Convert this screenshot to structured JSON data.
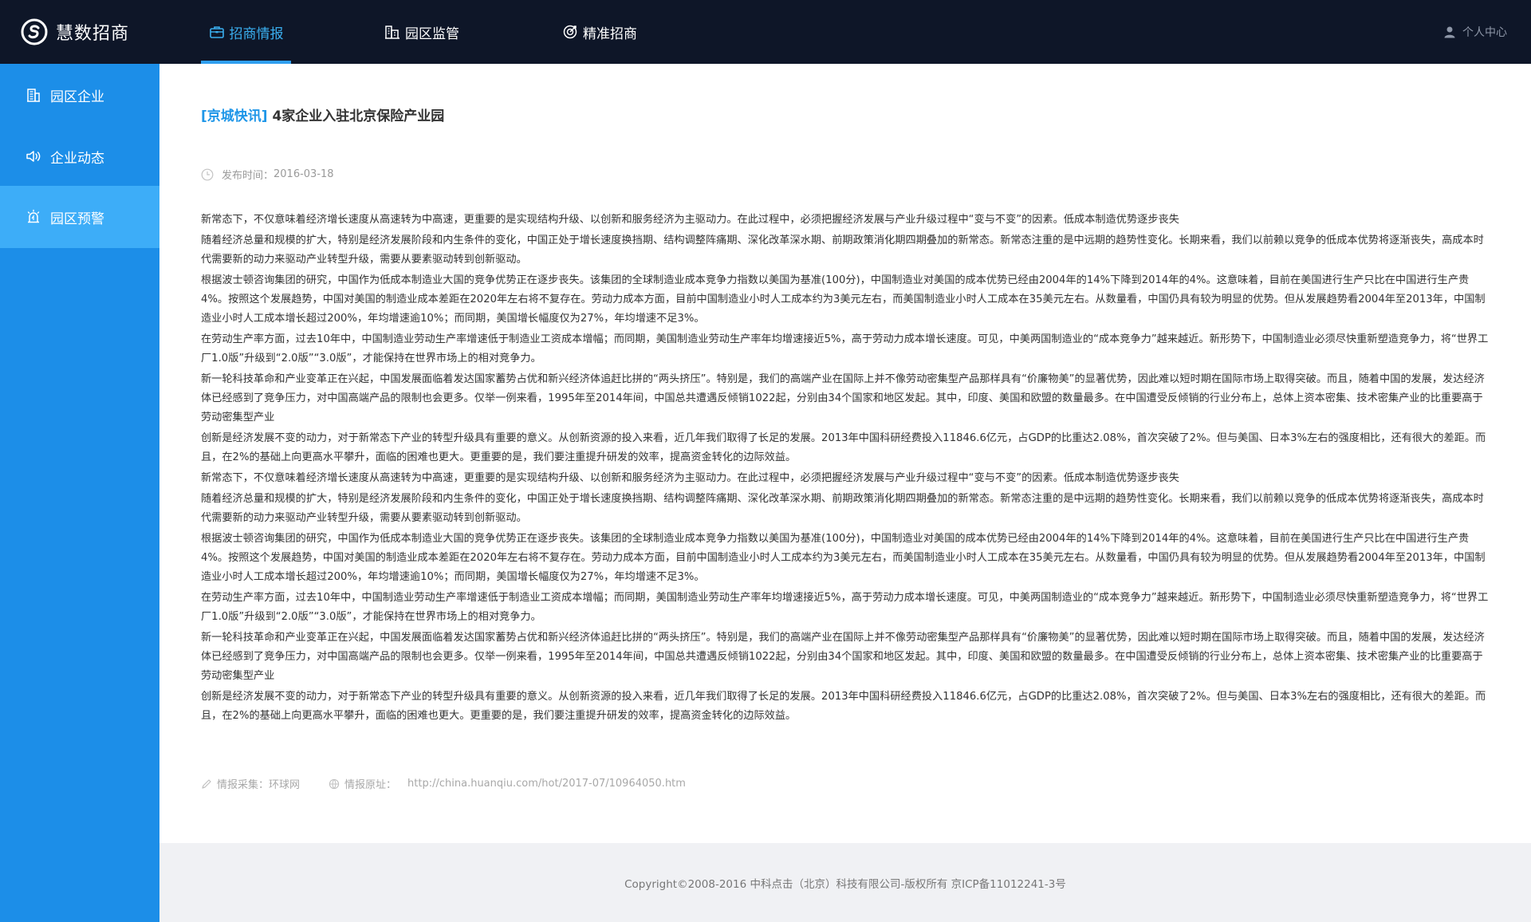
{
  "app": {
    "title": "慧数招商"
  },
  "nav": {
    "items": [
      {
        "label": "招商情报",
        "icon": "briefcase-icon",
        "active": true
      },
      {
        "label": "园区监管",
        "icon": "buildings-icon",
        "active": false
      },
      {
        "label": "精准招商",
        "icon": "target-icon",
        "active": false
      }
    ],
    "user_center": "个人中心"
  },
  "sidebar": {
    "items": [
      {
        "label": "园区企业",
        "icon": "building-icon",
        "active": false
      },
      {
        "label": "企业动态",
        "icon": "speaker-icon",
        "active": false
      },
      {
        "label": "园区预警",
        "icon": "alarm-icon",
        "active": true
      }
    ]
  },
  "article": {
    "tag": "[京城快讯]",
    "title": " 4家企业入驻北京保险产业园",
    "publish_label": "发布时间：",
    "publish_date": "2016-03-18",
    "paragraphs": [
      "新常态下，不仅意味着经济增长速度从高速转为中高速，更重要的是实现结构升级、以创新和服务经济为主驱动力。在此过程中，必须把握经济发展与产业升级过程中“变与不变”的因素。低成本制造优势逐步丧失",
      "随着经济总量和规模的扩大，特别是经济发展阶段和内生条件的变化，中国正处于增长速度换挡期、结构调整阵痛期、深化改革深水期、前期政策消化期四期叠加的新常态。新常态注重的是中远期的趋势性变化。长期来看，我们以前赖以竞争的低成本优势将逐渐丧失，高成本时代需要新的动力来驱动产业转型升级，需要从要素驱动转到创新驱动。",
      "根据波士顿咨询集团的研究，中国作为低成本制造业大国的竞争优势正在逐步丧失。该集团的全球制造业成本竞争力指数以美国为基准(100分)，中国制造业对美国的成本优势已经由2004年的14%下降到2014年的4%。这意味着，目前在美国进行生产只比在中国进行生产贵4%。按照这个发展趋势，中国对美国的制造业成本差距在2020年左右将不复存在。劳动力成本方面，目前中国制造业小时人工成本约为3美元左右，而美国制造业小时人工成本在35美元左右。从数量看，中国仍具有较为明显的优势。但从发展趋势看2004年至2013年，中国制造业小时人工成本增长超过200%，年均增速逾10%；而同期，美国增长幅度仅为27%，年均增速不足3%。",
      "在劳动生产率方面，过去10年中，中国制造业劳动生产率增速低于制造业工资成本增幅；而同期，美国制造业劳动生产率年均增速接近5%，高于劳动力成本增长速度。可见，中美两国制造业的“成本竞争力”越来越近。新形势下，中国制造业必须尽快重新塑造竞争力，将“世界工厂1.0版”升级到“2.0版”“3.0版”，才能保持在世界市场上的相对竞争力。",
      "新一轮科技革命和产业变革正在兴起，中国发展面临着发达国家蓄势占优和新兴经济体追赶比拼的“两头挤压”。特别是，我们的高端产业在国际上并不像劳动密集型产品那样具有“价廉物美”的显著优势，因此难以短时期在国际市场上取得突破。而且，随着中国的发展，发达经济体已经感到了竞争压力，对中国高端产品的限制也会更多。仅举一例来看，1995年至2014年间，中国总共遭遇反倾销1022起，分别由34个国家和地区发起。其中，印度、美国和欧盟的数量最多。在中国遭受反倾销的行业分布上，总体上资本密集、技术密集产业的比重要高于劳动密集型产业",
      "创新是经济发展不变的动力，对于新常态下产业的转型升级具有重要的意义。从创新资源的投入来看，近几年我们取得了长足的发展。2013年中国科研经费投入11846.6亿元，占GDP的比重达2.08%，首次突破了2%。但与美国、日本3%左右的强度相比，还有很大的差距。而且，在2%的基础上向更高水平攀升，面临的困难也更大。更重要的是，我们要注重提升研发的效率，提高资金转化的边际效益。",
      "新常态下，不仅意味着经济增长速度从高速转为中高速，更重要的是实现结构升级、以创新和服务经济为主驱动力。在此过程中，必须把握经济发展与产业升级过程中“变与不变”的因素。低成本制造优势逐步丧失",
      "随着经济总量和规模的扩大，特别是经济发展阶段和内生条件的变化，中国正处于增长速度换挡期、结构调整阵痛期、深化改革深水期、前期政策消化期四期叠加的新常态。新常态注重的是中远期的趋势性变化。长期来看，我们以前赖以竞争的低成本优势将逐渐丧失，高成本时代需要新的动力来驱动产业转型升级，需要从要素驱动转到创新驱动。",
      "根据波士顿咨询集团的研究，中国作为低成本制造业大国的竞争优势正在逐步丧失。该集团的全球制造业成本竞争力指数以美国为基准(100分)，中国制造业对美国的成本优势已经由2004年的14%下降到2014年的4%。这意味着，目前在美国进行生产只比在中国进行生产贵4%。按照这个发展趋势，中国对美国的制造业成本差距在2020年左右将不复存在。劳动力成本方面，目前中国制造业小时人工成本约为3美元左右，而美国制造业小时人工成本在35美元左右。从数量看，中国仍具有较为明显的优势。但从发展趋势看2004年至2013年，中国制造业小时人工成本增长超过200%，年均增速逾10%；而同期，美国增长幅度仅为27%，年均增速不足3%。",
      "在劳动生产率方面，过去10年中，中国制造业劳动生产率增速低于制造业工资成本增幅；而同期，美国制造业劳动生产率年均增速接近5%，高于劳动力成本增长速度。可见，中美两国制造业的“成本竞争力”越来越近。新形势下，中国制造业必须尽快重新塑造竞争力，将“世界工厂1.0版”升级到“2.0版”“3.0版”，才能保持在世界市场上的相对竞争力。",
      "新一轮科技革命和产业变革正在兴起，中国发展面临着发达国家蓄势占优和新兴经济体追赶比拼的“两头挤压”。特别是，我们的高端产业在国际上并不像劳动密集型产品那样具有“价廉物美”的显著优势，因此难以短时期在国际市场上取得突破。而且，随着中国的发展，发达经济体已经感到了竞争压力，对中国高端产品的限制也会更多。仅举一例来看，1995年至2014年间，中国总共遭遇反倾销1022起，分别由34个国家和地区发起。其中，印度、美国和欧盟的数量最多。在中国遭受反倾销的行业分布上，总体上资本密集、技术密集产业的比重要高于劳动密集型产业",
      "创新是经济发展不变的动力，对于新常态下产业的转型升级具有重要的意义。从创新资源的投入来看，近几年我们取得了长足的发展。2013年中国科研经费投入11846.6亿元，占GDP的比重达2.08%，首次突破了2%。但与美国、日本3%左右的强度相比，还有很大的差距。而且，在2%的基础上向更高水平攀升，面临的困难也更大。更重要的是，我们要注重提升研发的效率，提高资金转化的边际效益。"
    ],
    "source_label": "情报采集：",
    "source_value": "环球网",
    "url_label": "情报原址：",
    "url_value": "http://china.huanqiu.com/hot/2017-07/10964050.htm"
  },
  "footer": {
    "copyright": "Copyright©2008-2016 中科点击（北京）科技有限公司-版权所有  京ICP备11012241-3号"
  },
  "colors": {
    "topbar": "#0e1628",
    "sidebar": "#1c8ee8",
    "sidebar_active": "#3dadf8",
    "accent": "#1e96e8"
  }
}
